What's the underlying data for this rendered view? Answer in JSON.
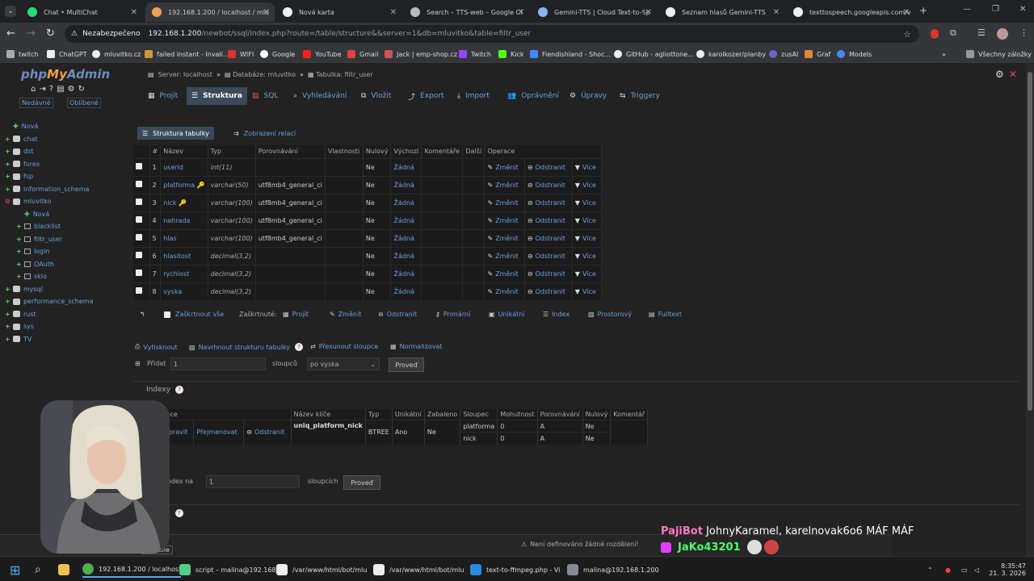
{
  "browser": {
    "tabs": [
      {
        "label": "Chat • MultiChat",
        "active": false
      },
      {
        "label": "192.168.1.200 / localhost / mlu",
        "active": true
      },
      {
        "label": "Nová karta",
        "active": false
      },
      {
        "label": "Search – TTS-web – Google Cl",
        "active": false
      },
      {
        "label": "Gemini-TTS  |  Cloud Text-to-Sp",
        "active": false
      },
      {
        "label": "Seznam hlasů Gemini-TTS",
        "active": false
      },
      {
        "label": "texttospeech.googleapis.com/v",
        "active": false
      }
    ],
    "security_label": "Nezabezpečeno",
    "url_host": "192.168.1.200",
    "url_rest": "/newbot/ssql/index.php?route=/table/structure&&server=1&db=mluvitko&table=filtr_user",
    "bookmarks": [
      "twitch",
      "ChatGPT",
      "mluvitko.cz",
      "failed instant - Invali...",
      "WIFI",
      "Google",
      "YouTube",
      "Gmail",
      "Jack | emp-shop.cz",
      "Twitch",
      "Kick",
      "Fiendishland - Shoc...",
      "GitHub - agliottone...",
      "karolkozer/planby",
      "zusAI",
      "Graf",
      "Models"
    ],
    "all_bookmarks": "Všechny záložky"
  },
  "sidebar": {
    "logo_php": "php",
    "logo_my": "My",
    "logo_admin": "Admin",
    "recent": "Nedávné",
    "favorites": "Oblíbené",
    "tree": [
      {
        "label": "Nová",
        "level": 0,
        "kind": "new"
      },
      {
        "label": "chat",
        "level": 0,
        "kind": "db"
      },
      {
        "label": "dst",
        "level": 0,
        "kind": "db"
      },
      {
        "label": "forex",
        "level": 0,
        "kind": "db"
      },
      {
        "label": "fsp",
        "level": 0,
        "kind": "db"
      },
      {
        "label": "information_schema",
        "level": 0,
        "kind": "db"
      },
      {
        "label": "mluvitko",
        "level": 0,
        "kind": "db-open"
      },
      {
        "label": "Nová",
        "level": 1,
        "kind": "new"
      },
      {
        "label": "blacklist",
        "level": 1,
        "kind": "table"
      },
      {
        "label": "filtr_user",
        "level": 1,
        "kind": "table"
      },
      {
        "label": "login",
        "level": 1,
        "kind": "table"
      },
      {
        "label": "OAuth",
        "level": 1,
        "kind": "table"
      },
      {
        "label": "sklo",
        "level": 1,
        "kind": "table"
      },
      {
        "label": "mysql",
        "level": 0,
        "kind": "db"
      },
      {
        "label": "performance_schema",
        "level": 0,
        "kind": "db"
      },
      {
        "label": "rust",
        "level": 0,
        "kind": "db"
      },
      {
        "label": "sys",
        "level": 0,
        "kind": "db"
      },
      {
        "label": "TV",
        "level": 0,
        "kind": "db"
      }
    ]
  },
  "breadcrumb": {
    "server": "Server: localhost",
    "database": "Databáze: mluvitko",
    "table": "Tabulka: filtr_user"
  },
  "menu": [
    "Projít",
    "Struktura",
    "SQL",
    "Vyhledávání",
    "Vložit",
    "Export",
    "Import",
    "Oprávnění",
    "Úpravy",
    "Triggery"
  ],
  "subtabs": {
    "structure": "Struktura tabulky",
    "relations": "Zobrazení relací"
  },
  "structure": {
    "headers": [
      "#",
      "Název",
      "Typ",
      "Porovnávání",
      "Vlastnosti",
      "Nulový",
      "Výchozí",
      "Komentáře",
      "Další",
      "Operace"
    ],
    "rows": [
      {
        "n": "1",
        "name": "userid",
        "type": "int(11)",
        "collation": "",
        "null": "Ne",
        "default": "Žádná",
        "key": false
      },
      {
        "n": "2",
        "name": "platforma",
        "type": "varchar(50)",
        "collation": "utf8mb4_general_ci",
        "null": "Ne",
        "default": "Žádná",
        "key": true
      },
      {
        "n": "3",
        "name": "nick",
        "type": "varchar(100)",
        "collation": "utf8mb4_general_ci",
        "null": "Ne",
        "default": "Žádná",
        "key": true
      },
      {
        "n": "4",
        "name": "nahrada",
        "type": "varchar(100)",
        "collation": "utf8mb4_general_ci",
        "null": "Ne",
        "default": "Žádná",
        "key": false
      },
      {
        "n": "5",
        "name": "hlas",
        "type": "varchar(100)",
        "collation": "utf8mb4_general_ci",
        "null": "Ne",
        "default": "Žádná",
        "key": false
      },
      {
        "n": "6",
        "name": "hlasitost",
        "type": "decimal(3,2)",
        "collation": "",
        "null": "Ne",
        "default": "Žádná",
        "key": false
      },
      {
        "n": "7",
        "name": "rychlost",
        "type": "decimal(3,2)",
        "collation": "",
        "null": "Ne",
        "default": "Žádná",
        "key": false
      },
      {
        "n": "8",
        "name": "vyska",
        "type": "decimal(3,2)",
        "collation": "",
        "null": "Ne",
        "default": "Žádná",
        "key": false
      }
    ],
    "op_change": "Změnit",
    "op_drop": "Odstranit",
    "op_more": "Více"
  },
  "bulk": {
    "check_all": "Zaškrtnout vše",
    "checked": "Zaškrtnuté:",
    "actions": [
      "Projít",
      "Změnit",
      "Odstranit",
      "Primární",
      "Unikátní",
      "Index",
      "Prostorový",
      "Fulltext"
    ]
  },
  "tools": {
    "print": "Vytisknout",
    "propose": "Navrhnout strukturu tabulky",
    "move": "Přesunout sloupce",
    "normalize": "Normalizovat",
    "add_label": "Přidat",
    "add_value": "1",
    "columns_label": "sloupců",
    "after_value": "po vyska",
    "go": "Proveď"
  },
  "indexes": {
    "legend": "Indexy",
    "headers": [
      "Operace",
      "Název klíče",
      "Typ",
      "Unikátní",
      "Zabaleno",
      "Sloupec",
      "Mohutnost",
      "Porovnávání",
      "Nulový",
      "Komentář"
    ],
    "edit": "Upravit",
    "rename": "Přejmenovat",
    "drop": "Odstranit",
    "key_name": "uniq_platform_nick",
    "type": "BTREE",
    "unique": "Ano",
    "packed": "Ne",
    "columns": [
      {
        "col": "platforma",
        "card": "0",
        "coll": "A",
        "null": "Ne"
      },
      {
        "col": "nick",
        "card": "0",
        "coll": "A",
        "null": "Ne"
      }
    ],
    "create_label": "t index na",
    "create_value": "1",
    "create_cols": "sloupcích",
    "go": "Proveď",
    "partitions_legend": "ly"
  },
  "console": "Konzole",
  "notice": "Není definováno žádné rozdělení!",
  "chat": {
    "line1_user": "PajiBot",
    "line1_text": "JohnyKaramel, karelnovak6o6 MÁF MÁF",
    "line2_user": "JaKo43201"
  },
  "taskbar": {
    "items": [
      "192.168.1.200 / localhost",
      "script – malina@192.168",
      "/var/www/html/bot/mlu",
      "/var/www/html/bot/mlu",
      "text-to-ffmpeg.php - Vi",
      "malina@192.168.1.200"
    ],
    "time": "8:35:47",
    "date": "21. 3. 2026"
  },
  "colors": {
    "accent": "#6ca0dc",
    "chat_user1": "#ff79c6",
    "chat_user2": "#4cff6a"
  }
}
